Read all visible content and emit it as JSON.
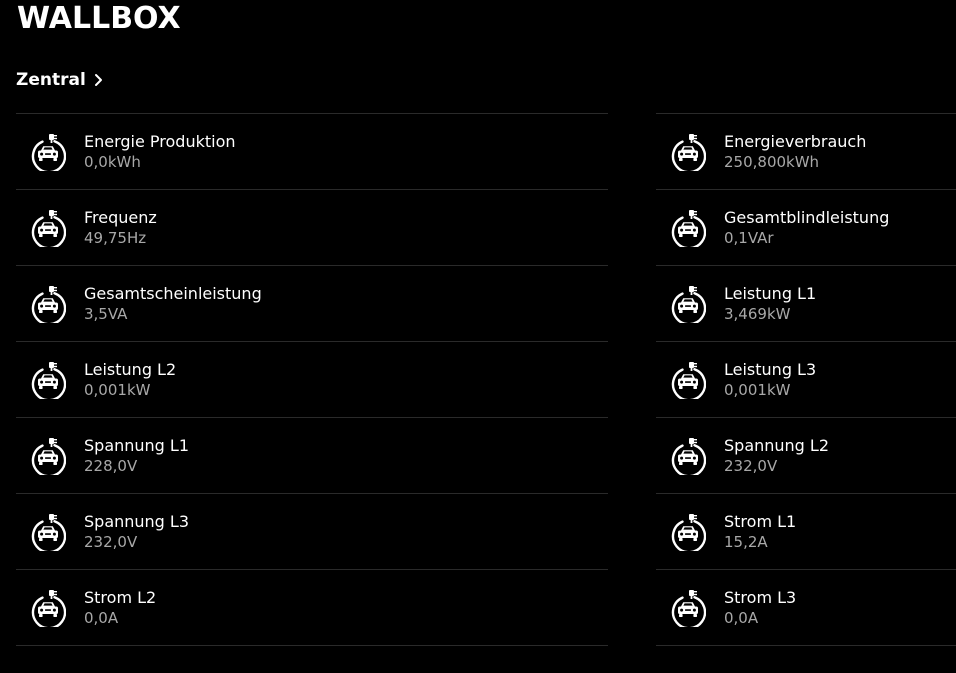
{
  "header": {
    "title": "WALLBOX"
  },
  "breadcrumb": {
    "label": "Zentral"
  },
  "icon": "ev-charger-car-icon",
  "colors": {
    "background": "#000000",
    "text": "#ffffff",
    "value_text": "#a8a8a8",
    "divider": "#2a2a2a"
  },
  "left_items": [
    {
      "label": "Energie Produktion",
      "value": "0,0kWh"
    },
    {
      "label": "Frequenz",
      "value": "49,75Hz"
    },
    {
      "label": "Gesamtscheinleistung",
      "value": "3,5VA"
    },
    {
      "label": "Leistung L2",
      "value": "0,001kW"
    },
    {
      "label": "Spannung L1",
      "value": "228,0V"
    },
    {
      "label": "Spannung L3",
      "value": "232,0V"
    },
    {
      "label": "Strom L2",
      "value": "0,0A"
    }
  ],
  "right_items": [
    {
      "label": "Energieverbrauch",
      "value": "250,800kWh"
    },
    {
      "label": "Gesamtblindleistung",
      "value": "0,1VAr"
    },
    {
      "label": "Leistung L1",
      "value": "3,469kW"
    },
    {
      "label": "Leistung L3",
      "value": "0,001kW"
    },
    {
      "label": "Spannung L2",
      "value": "232,0V"
    },
    {
      "label": "Strom L1",
      "value": "15,2A"
    },
    {
      "label": "Strom L3",
      "value": "0,0A"
    }
  ]
}
